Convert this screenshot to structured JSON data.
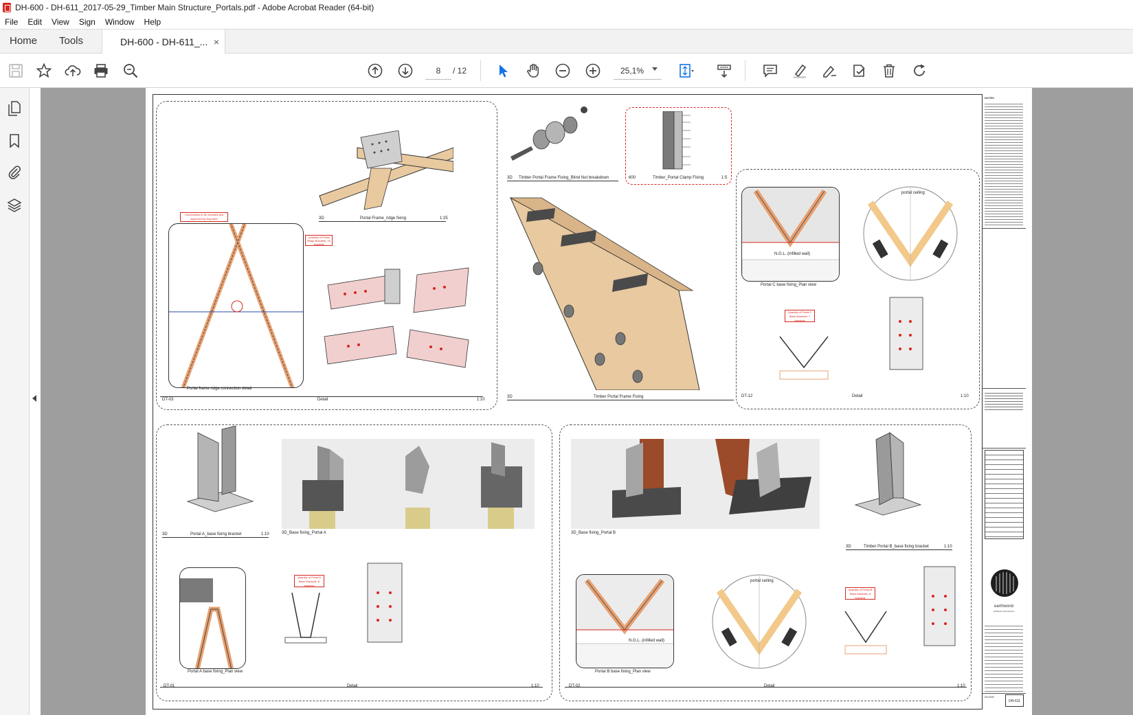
{
  "window": {
    "title": "DH-600 - DH-611_2017-05-29_Timber Main Structure_Portals.pdf - Adobe Acrobat Reader (64-bit)"
  },
  "menu": {
    "items": [
      "File",
      "Edit",
      "View",
      "Sign",
      "Window",
      "Help"
    ]
  },
  "tabs": {
    "home": "Home",
    "tools": "Tools",
    "document": "DH-600 - DH-611_...",
    "close": "×"
  },
  "toolbar": {
    "current_page": "8",
    "page_total": "/ 12",
    "zoom": "25,1%"
  },
  "sheet": {
    "panel1": {
      "note_connections": "Connections to be checked and approved by Eng here",
      "note_quantity": "Quantity of Portal Ridge Brackets: 15 brackets",
      "cap_ridge": "Portal Frame_ridge fixing",
      "cap_ridge_scale": "1:25",
      "cap_ridge_prefix": "3D",
      "cap_detail_plan": "Portal frame ridge connection detail",
      "footer_id": "DT-03",
      "footer_title": "Detail",
      "footer_scale": "1:10"
    },
    "panel2": {
      "cap_blindnut": "Timber Portal Frame Fixing_Blind Nut breakdown",
      "cap_blindnut_prefix": "3D",
      "cap_clamp": "Timber_Portal Clamp Fixing",
      "cap_clamp_prefix": "600",
      "cap_clamp_scale": "1:5",
      "footer_prefix": "3D",
      "footer_title": "Timber Portal Frame Fixing"
    },
    "panel3": {
      "note_quantity": "Quantity of Portal C Base Brackets: 7 brackets",
      "cap_plan": "Portal C base fixing_Plan view",
      "label_portal_ceiling": "portal ceiling",
      "label_ngl": "N.G.L. (infilled wall)",
      "footer_id": "DT-12",
      "footer_title": "Detail",
      "footer_scale": "1:10"
    },
    "panel4": {
      "cap_bracket": "Portal A_base fixing bracket",
      "cap_bracket_prefix": "3D",
      "cap_bracket_scale": "1:10",
      "cap_render": "3D_Base fixing_Portal A",
      "note_quantity": "Quantity of Portal A Base Brackets: 8 brackets",
      "cap_plan": "Portal A base fixing_Plan view",
      "footer_id": "DT-01",
      "footer_title": "Detail",
      "footer_scale": "1:10"
    },
    "panel5": {
      "cap_render": "3D_Base fixing_Portal B",
      "cap_bracket": "Timber Portal B_base fixing bracket",
      "cap_bracket_prefix": "3D",
      "cap_bracket_scale": "1:10",
      "label_portal_ceiling": "portal ceiling",
      "label_ngl": "N.G.L. (infilled wall)",
      "note_quantity": "Quantity of Portal B Base Brackets: 8 brackets",
      "cap_plan": "Portal B base fixing_Plan view",
      "footer_id": "DT-02",
      "footer_title": "Detail",
      "footer_scale": "1:10"
    },
    "titleblock": {
      "header": "NOTES",
      "company": "earthworld",
      "company_sub": "architects and interiors",
      "sheet_no": "DH-611",
      "drawing_set": "DH-600"
    }
  },
  "colors": {
    "accent_red": "#d7261e",
    "timber": "#e8c9a0",
    "steel": "#7a7a7a",
    "gray_bg": "#9e9e9e",
    "select_blue": "#1473e6"
  }
}
